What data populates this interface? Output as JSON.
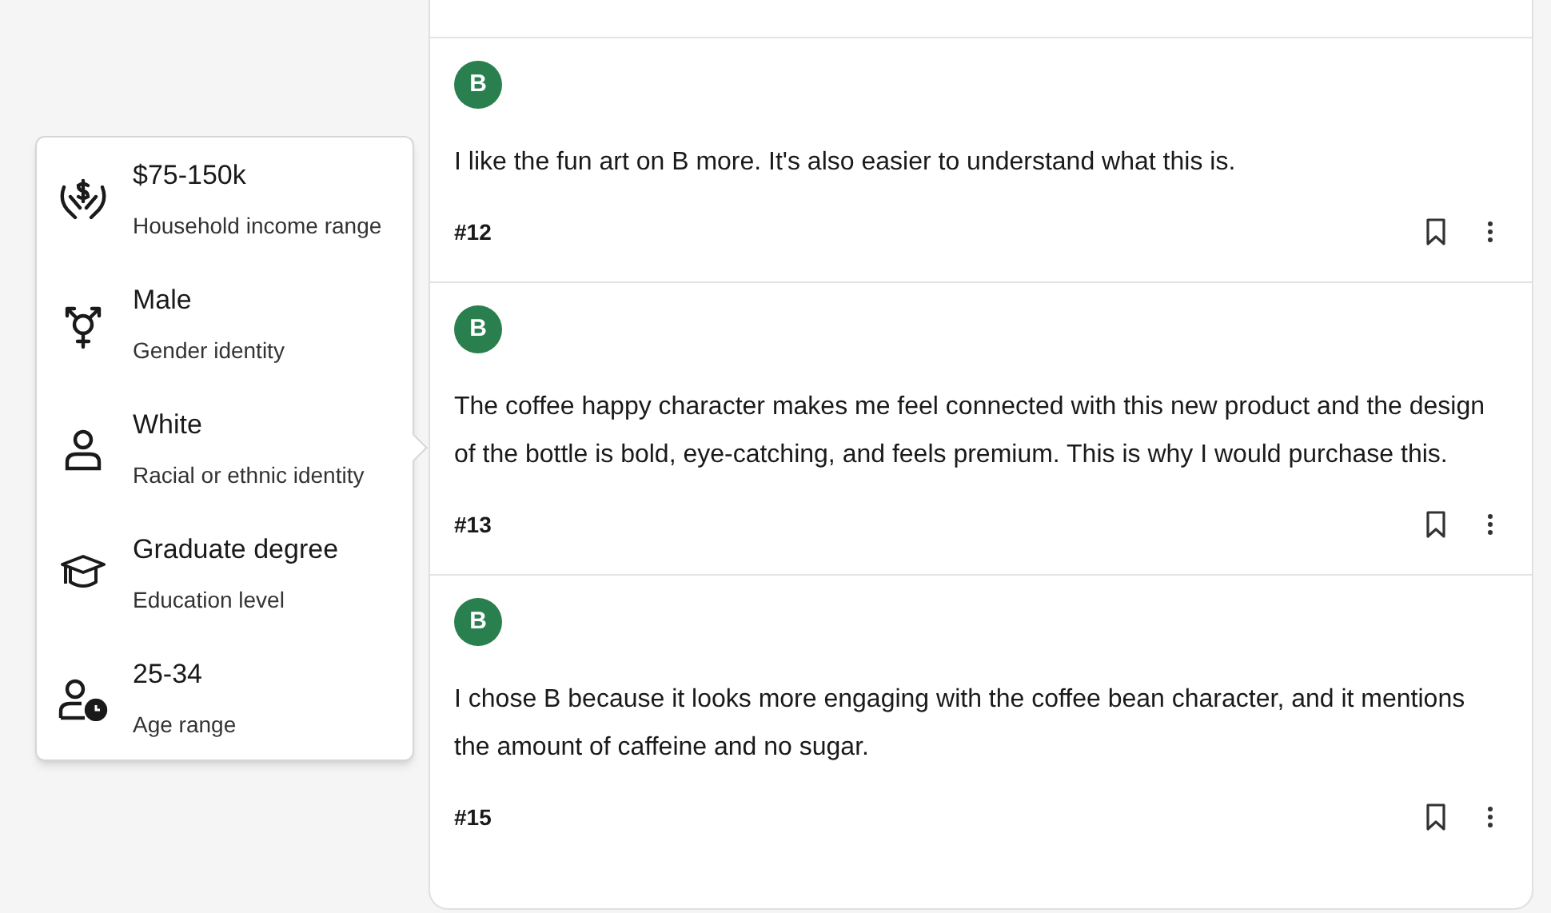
{
  "demographics": [
    {
      "kind": "income",
      "value": "$75-150k",
      "label": "Household income range"
    },
    {
      "kind": "gender",
      "value": "Male",
      "label": "Gender identity"
    },
    {
      "kind": "person",
      "value": "White",
      "label": "Racial or ethnic identity"
    },
    {
      "kind": "education",
      "value": "Graduate degree",
      "label": "Education level"
    },
    {
      "kind": "age",
      "value": "25-34",
      "label": "Age range"
    }
  ],
  "responses": [
    {
      "choice": "B",
      "text": "I like the fun art on B more. It's also easier to understand what this is.",
      "number": "#12"
    },
    {
      "choice": "B",
      "text": "The coffee happy character makes me feel connected with this new product and the design of the bottle is bold, eye-catching, and feels premium. This is why I would purchase this.",
      "number": "#13"
    },
    {
      "choice": "B",
      "text": "I chose B because it looks more engaging with the coffee bean character, and it mentions the amount of caffeine and no sugar.",
      "number": "#15"
    }
  ]
}
